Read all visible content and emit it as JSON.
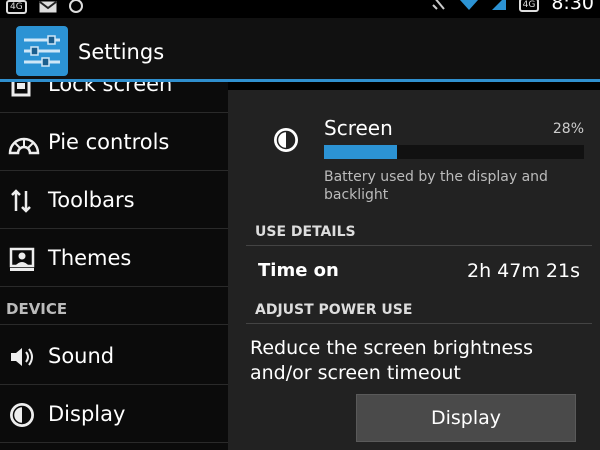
{
  "status_bar": {
    "left_badge": "4G",
    "right_badge": "4G",
    "time": "8:30"
  },
  "action_bar": {
    "title": "Settings"
  },
  "left_pane": {
    "items_top": [
      {
        "label": "Lock screen",
        "icon": "lock-screen-icon"
      },
      {
        "label": "Pie controls",
        "icon": "pie-controls-icon"
      },
      {
        "label": "Toolbars",
        "icon": "toolbars-icon"
      },
      {
        "label": "Themes",
        "icon": "themes-icon"
      }
    ],
    "section_device": "DEVICE",
    "items_device": [
      {
        "label": "Sound",
        "icon": "sound-icon"
      },
      {
        "label": "Display",
        "icon": "display-icon"
      }
    ]
  },
  "detail": {
    "name": "Screen",
    "percent": "28%",
    "percent_value": 28,
    "description": "Battery used by the display and backlight",
    "use_details_header": "USE DETAILS",
    "time_on_label": "Time on",
    "time_on_value": "2h 47m 21s",
    "adjust_header": "ADJUST POWER USE",
    "adjust_description": "Reduce the screen brightness and/or screen timeout",
    "display_button": "Display"
  },
  "colors": {
    "accent": "#2c93d4",
    "divider": "#2f8fce"
  }
}
